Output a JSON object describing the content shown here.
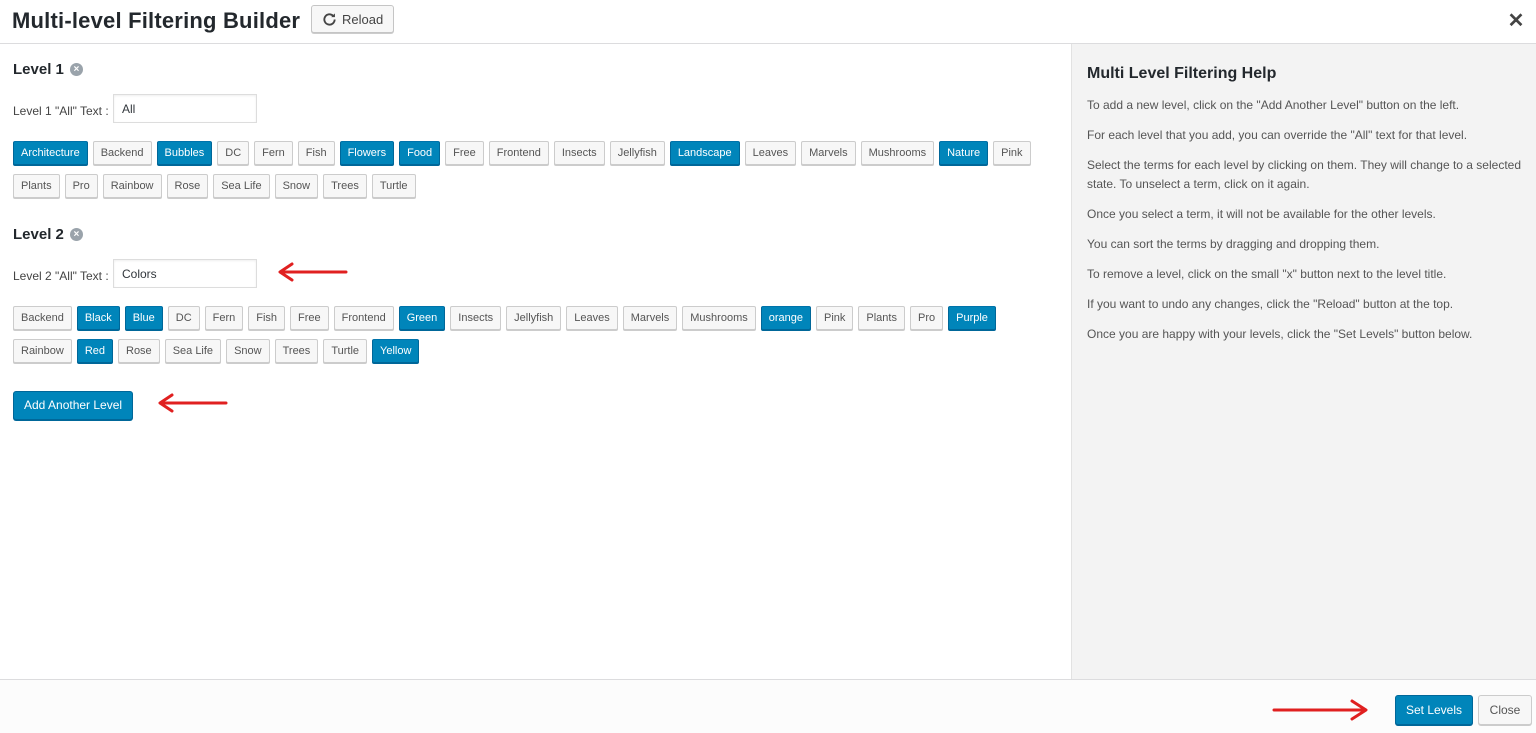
{
  "header": {
    "title": "Multi-level Filtering Builder",
    "reload_label": "Reload",
    "close_glyph": "✕"
  },
  "levels": [
    {
      "title": "Level 1",
      "all_label": "Level 1 \"All\" Text :",
      "all_value": "All",
      "terms": [
        {
          "label": "Architecture",
          "selected": true
        },
        {
          "label": "Backend",
          "selected": false
        },
        {
          "label": "Bubbles",
          "selected": true
        },
        {
          "label": "DC",
          "selected": false
        },
        {
          "label": "Fern",
          "selected": false
        },
        {
          "label": "Fish",
          "selected": false
        },
        {
          "label": "Flowers",
          "selected": true
        },
        {
          "label": "Food",
          "selected": true
        },
        {
          "label": "Free",
          "selected": false
        },
        {
          "label": "Frontend",
          "selected": false
        },
        {
          "label": "Insects",
          "selected": false
        },
        {
          "label": "Jellyfish",
          "selected": false
        },
        {
          "label": "Landscape",
          "selected": true
        },
        {
          "label": "Leaves",
          "selected": false
        },
        {
          "label": "Marvels",
          "selected": false
        },
        {
          "label": "Mushrooms",
          "selected": false
        },
        {
          "label": "Nature",
          "selected": true
        },
        {
          "label": "Pink",
          "selected": false
        },
        {
          "label": "Plants",
          "selected": false
        },
        {
          "label": "Pro",
          "selected": false
        },
        {
          "label": "Rainbow",
          "selected": false
        },
        {
          "label": "Rose",
          "selected": false
        },
        {
          "label": "Sea Life",
          "selected": false
        },
        {
          "label": "Snow",
          "selected": false
        },
        {
          "label": "Trees",
          "selected": false
        },
        {
          "label": "Turtle",
          "selected": false
        }
      ]
    },
    {
      "title": "Level 2",
      "all_label": "Level 2 \"All\" Text :",
      "all_value": "Colors",
      "terms": [
        {
          "label": "Backend",
          "selected": false
        },
        {
          "label": "Black",
          "selected": true
        },
        {
          "label": "Blue",
          "selected": true
        },
        {
          "label": "DC",
          "selected": false
        },
        {
          "label": "Fern",
          "selected": false
        },
        {
          "label": "Fish",
          "selected": false
        },
        {
          "label": "Free",
          "selected": false
        },
        {
          "label": "Frontend",
          "selected": false
        },
        {
          "label": "Green",
          "selected": true
        },
        {
          "label": "Insects",
          "selected": false
        },
        {
          "label": "Jellyfish",
          "selected": false
        },
        {
          "label": "Leaves",
          "selected": false
        },
        {
          "label": "Marvels",
          "selected": false
        },
        {
          "label": "Mushrooms",
          "selected": false
        },
        {
          "label": "orange",
          "selected": true
        },
        {
          "label": "Pink",
          "selected": false
        },
        {
          "label": "Plants",
          "selected": false
        },
        {
          "label": "Pro",
          "selected": false
        },
        {
          "label": "Purple",
          "selected": true
        },
        {
          "label": "Rainbow",
          "selected": false
        },
        {
          "label": "Red",
          "selected": true
        },
        {
          "label": "Rose",
          "selected": false
        },
        {
          "label": "Sea Life",
          "selected": false
        },
        {
          "label": "Snow",
          "selected": false
        },
        {
          "label": "Trees",
          "selected": false
        },
        {
          "label": "Turtle",
          "selected": false
        },
        {
          "label": "Yellow",
          "selected": true
        }
      ]
    }
  ],
  "add_level_label": "Add Another Level",
  "help": {
    "title": "Multi Level Filtering Help",
    "paragraphs": [
      "To add a new level, click on the \"Add Another Level\" button on the left.",
      "For each level that you add, you can override the \"All\" text for that level.",
      "Select the terms for each level by clicking on them. They will change to a selected state. To unselect a term, click on it again.",
      "Once you select a term, it will not be available for the other levels.",
      "You can sort the terms by dragging and dropping them.",
      "To remove a level, click on the small \"x\" button next to the level title.",
      "If you want to undo any changes, click the \"Reload\" button at the top.",
      "Once you are happy with your levels, click the \"Set Levels\" button below."
    ]
  },
  "footer": {
    "set_levels_label": "Set Levels",
    "close_label": "Close"
  },
  "colors": {
    "accent": "#0085ba",
    "annotation_arrow": "#e02020"
  }
}
